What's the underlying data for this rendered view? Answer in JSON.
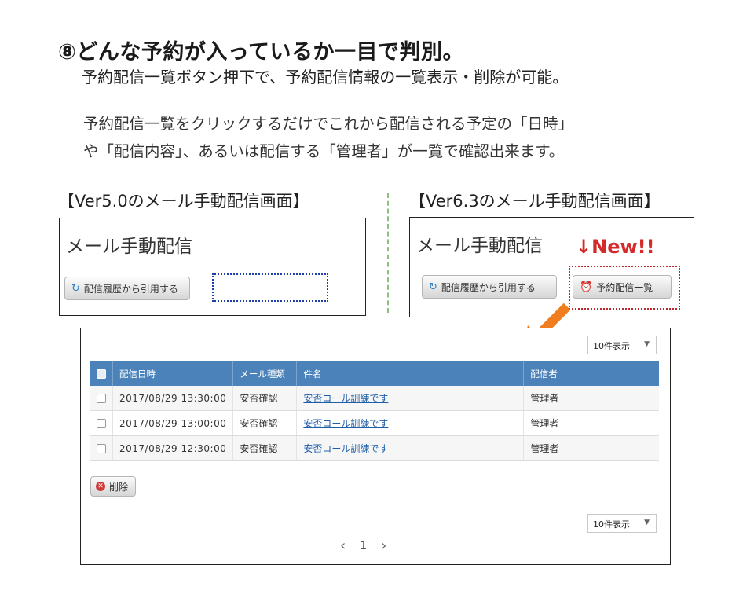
{
  "title": "⑧どんな予約が入っているか一目で判別。",
  "subtitle": "予約配信一覧ボタン押下で、予約配信情報の一覧表示・削除が可能。",
  "description_lines": [
    "予約配信一覧をクリックするだけでこれから配信される予定の「日時」",
    "や「配信内容」、あるいは配信する「管理者」が一覧で確認出来ます。"
  ],
  "left_caption": "【Ver5.0のメール手動配信画面】",
  "right_caption": "【Ver6.3のメール手動配信画面】",
  "window_title": "メール手動配信",
  "history_button": "配信履歴から引用する",
  "reserve_button": "予約配信一覧",
  "new_label": "↓New!!",
  "per_page": "10件表示",
  "table": {
    "headers": [
      "配信日時",
      "メール種類",
      "件名",
      "配信者"
    ],
    "rows": [
      {
        "datetime": "2017/08/29 13:30:00",
        "type": "安否確認",
        "subject": "安否コール訓練です",
        "sender": "管理者"
      },
      {
        "datetime": "2017/08/29 13:00:00",
        "type": "安否確認",
        "subject": "安否コール訓練です",
        "sender": "管理者"
      },
      {
        "datetime": "2017/08/29 12:30:00",
        "type": "安否確認",
        "subject": "安否コール訓練です",
        "sender": "管理者"
      }
    ]
  },
  "delete_button": "削除",
  "pagination": {
    "current": "1"
  },
  "icons": {
    "history": "refresh-icon",
    "reserve": "alarm-clock-icon",
    "delete": "close-circle-icon",
    "prev": "chevron-left-icon",
    "next": "chevron-right-icon",
    "dropdown": "caret-down-icon"
  },
  "colors": {
    "table_header": "#4a82b9",
    "new_label": "#d42a2a",
    "arrow": "#f07d1e",
    "link": "#1f5fa8"
  }
}
